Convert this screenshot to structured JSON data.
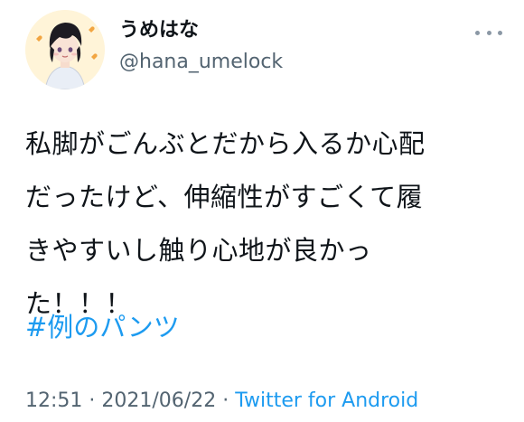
{
  "user": {
    "display_name": "うめはな",
    "handle": "@hana_umelock",
    "avatar_icon": "avatar-illustration-icon"
  },
  "more_icon": "more-horizontal-icon",
  "tweet": {
    "lines": [
      "私脚がごんぶとだから入るか心配",
      "だったけど、伸縮性がすごくて履",
      "きやすいし触り心地が良かっ",
      "た！！！"
    ],
    "hashtag": "#例のパンツ"
  },
  "meta": {
    "time": "12:51",
    "sep1": " · ",
    "date": "2021/06/22",
    "sep2": " · ",
    "source": "Twitter for Android"
  },
  "colors": {
    "link": "#1d9bf0",
    "secondary_text": "#536471",
    "primary_text": "#0f1419"
  }
}
